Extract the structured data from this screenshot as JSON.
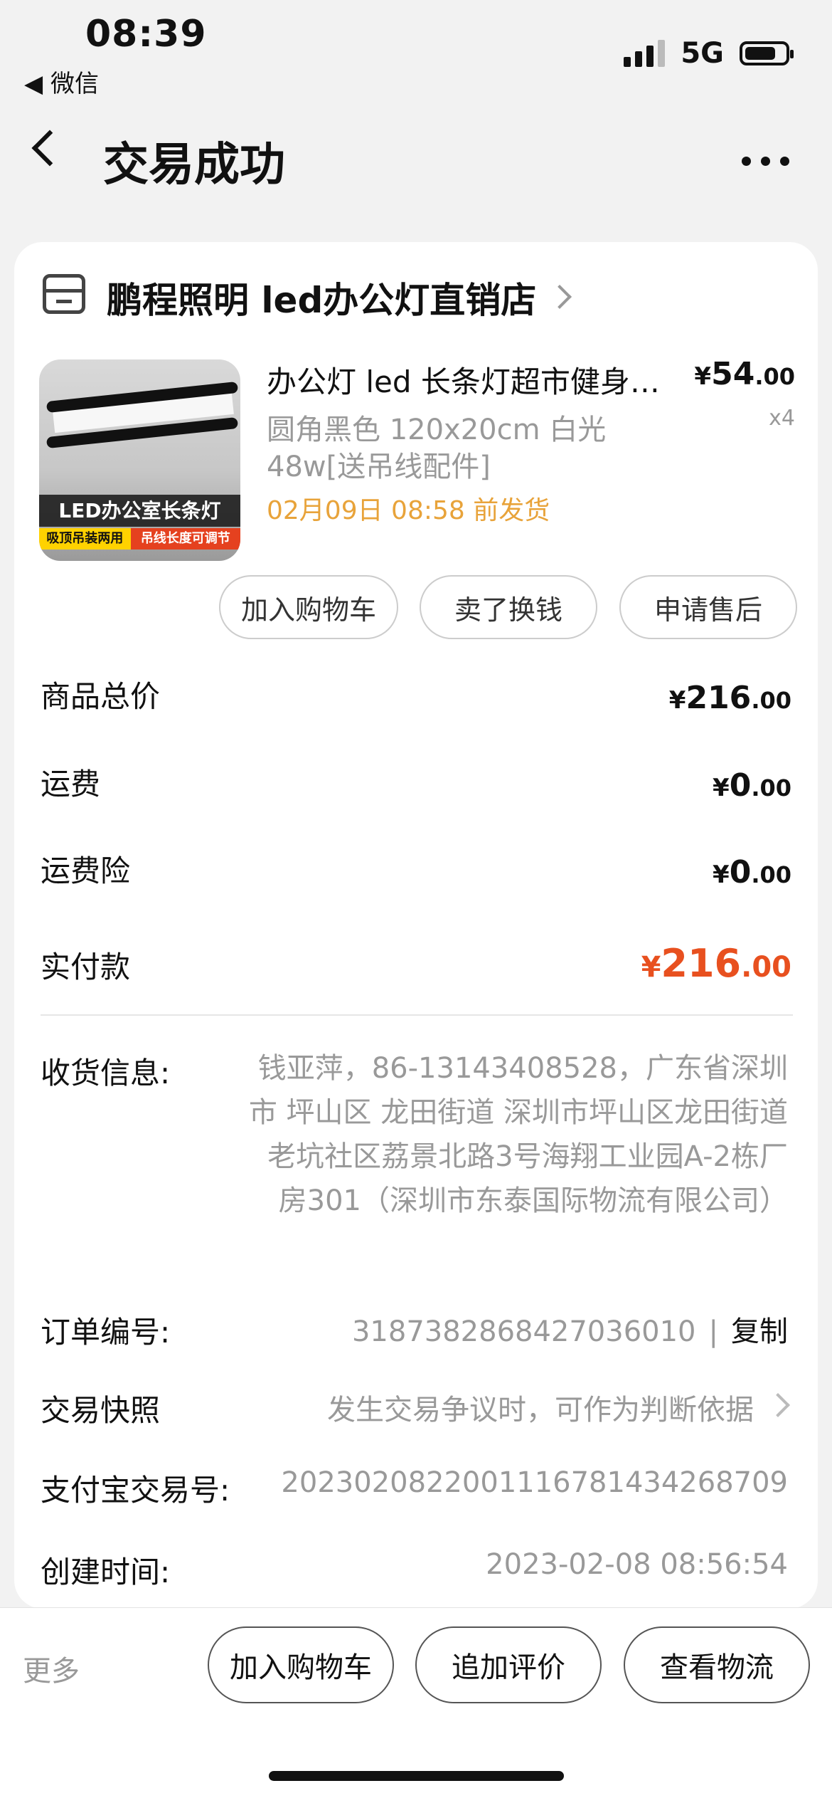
{
  "status_bar": {
    "time": "08:39",
    "back_app": "◀ 微信",
    "network": "5G"
  },
  "header": {
    "title": "交易成功",
    "back_icon": "chevron-left-icon",
    "more_icon": "more-dots-icon"
  },
  "store": {
    "name": "鹏程照明 led办公灯直销店"
  },
  "item": {
    "image_banner": "LED办公室长条灯",
    "image_tag_left": "吸顶吊装两用",
    "image_tag_right": "吊线长度可调节",
    "name": "办公灯 led 长条灯超市健身房商用吊灯",
    "price_cur": "¥",
    "price_int": "54",
    "price_dec": ".00",
    "qty": "x4",
    "spec": "圆角黑色 120x20cm 白光 48w[送吊线配件]",
    "ship": "02月09日 08:58 前发货"
  },
  "item_actions": {
    "cart": "加入购物车",
    "resell": "卖了换钱",
    "after_sale": "申请售后"
  },
  "summary": {
    "goods_total_label": "商品总价",
    "goods_total_cur": "¥",
    "goods_total_int": "216",
    "goods_total_dec": ".00",
    "shipping_label": "运费",
    "shipping_cur": "¥",
    "shipping_int": "0",
    "shipping_dec": ".00",
    "insurance_label": "运费险",
    "insurance_cur": "¥",
    "insurance_int": "0",
    "insurance_dec": ".00",
    "paid_label": "实付款",
    "paid_cur": "¥",
    "paid_int": "216",
    "paid_dec": ".00"
  },
  "order_info": {
    "address_label": "收货信息:",
    "address_value": "钱亚萍，86-13143408528，广东省深圳市 坪山区 龙田街道 深圳市坪山区龙田街道老坑社区荔景北路3号海翔工业园A-2栋厂房301（深圳市东泰国际物流有限公司）",
    "order_no_label": "订单编号:",
    "order_no": "3187382868427036010",
    "copy_sep": "|",
    "copy_label": "复制",
    "snapshot_label": "交易快照",
    "snapshot_value": "发生交易争议时，可作为判断依据",
    "alipay_label": "支付宝交易号:",
    "alipay_no": "2023020822001116781434268709",
    "created_label": "创建时间:",
    "created_value": "2023-02-08 08:56:54"
  },
  "bottom_bar": {
    "more": "更多",
    "cart": "加入购物车",
    "review": "追加评价",
    "logistics": "查看物流"
  },
  "colors": {
    "accent_orange": "#e8501f",
    "ship_gold": "#e8a33a",
    "muted": "#999999"
  }
}
